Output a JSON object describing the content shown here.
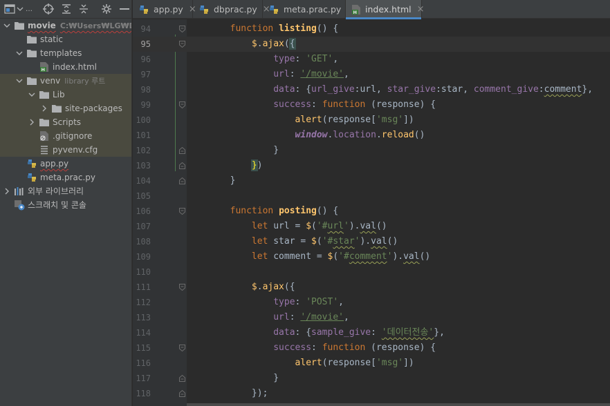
{
  "toolbar": {
    "icons": [
      "project-view-icon",
      "dropdown-icon",
      "locate-icon",
      "expand-all-icon",
      "collapse-all-icon",
      "settings-icon",
      "hide-icon"
    ]
  },
  "project_tree": [
    {
      "label": "movie",
      "hint": "C:₩Users₩LG₩Deskto",
      "level": 0,
      "arrow": "down",
      "icon": "folder",
      "bold": true,
      "wavy": true
    },
    {
      "label": "static",
      "hint": "",
      "level": 1,
      "arrow": "",
      "icon": "folder"
    },
    {
      "label": "templates",
      "hint": "",
      "level": 1,
      "arrow": "down",
      "icon": "folder"
    },
    {
      "label": "index.html",
      "hint": "",
      "level": 2,
      "arrow": "",
      "icon": "html"
    },
    {
      "label": "venv",
      "hint": "library 루트",
      "level": 0,
      "indent": 1,
      "arrow": "down",
      "icon": "folder",
      "venv": true
    },
    {
      "label": "Lib",
      "hint": "",
      "level": 2,
      "arrow": "down",
      "icon": "folder",
      "venv": true
    },
    {
      "label": "site-packages",
      "hint": "",
      "level": 3,
      "arrow": "right",
      "icon": "folder",
      "venv": true
    },
    {
      "label": "Scripts",
      "hint": "",
      "level": 2,
      "arrow": "right",
      "icon": "folder",
      "venv": true
    },
    {
      "label": ".gitignore",
      "hint": "",
      "level": 2,
      "arrow": "",
      "icon": "gitignore",
      "venv": true
    },
    {
      "label": "pyvenv.cfg",
      "hint": "",
      "level": 2,
      "arrow": "",
      "icon": "cfg",
      "venv": true
    },
    {
      "label": "app.py",
      "hint": "",
      "level": 1,
      "arrow": "",
      "icon": "python",
      "wavy": true
    },
    {
      "label": "meta.prac.py",
      "hint": "",
      "level": 1,
      "arrow": "",
      "icon": "python"
    },
    {
      "label": "외부 라이브러리",
      "hint": "",
      "level": 0,
      "arrow": "right",
      "icon": "library"
    },
    {
      "label": "스크래치 및 콘솔",
      "hint": "",
      "level": 0,
      "arrow": "",
      "icon": "scratch"
    }
  ],
  "tabs": [
    {
      "label": "app.py",
      "icon": "python",
      "active": false
    },
    {
      "label": "dbprac.py",
      "icon": "python",
      "active": false
    },
    {
      "label": "meta.prac.py",
      "icon": "python",
      "active": false
    },
    {
      "label": "index.html",
      "icon": "html",
      "active": true
    }
  ],
  "tab_close": "×",
  "editor": {
    "current_line": 95,
    "lines": [
      {
        "n": 94,
        "fold": "open",
        "tokens": [
          [
            "pl",
            "        "
          ],
          [
            "kw",
            "function "
          ],
          [
            "fnb",
            "listing"
          ],
          [
            "pl",
            "() {"
          ]
        ]
      },
      {
        "n": 95,
        "fold": "open",
        "tokens": [
          [
            "pl",
            "            "
          ],
          [
            "fn",
            "$"
          ],
          [
            "pl",
            "."
          ],
          [
            "fn",
            "ajax"
          ],
          [
            "pl",
            "("
          ],
          [
            "brk",
            "{"
          ]
        ]
      },
      {
        "n": 96,
        "fold": "",
        "tokens": [
          [
            "pl",
            "                "
          ],
          [
            "prop",
            "type"
          ],
          [
            "pl",
            ": "
          ],
          [
            "str",
            "'GET'"
          ],
          [
            "pl",
            ","
          ]
        ]
      },
      {
        "n": 97,
        "fold": "",
        "tokens": [
          [
            "pl",
            "                "
          ],
          [
            "prop",
            "url"
          ],
          [
            "pl",
            ": "
          ],
          [
            "stru",
            "'/movie'"
          ],
          [
            "pl",
            ","
          ]
        ]
      },
      {
        "n": 98,
        "fold": "",
        "tokens": [
          [
            "pl",
            "                "
          ],
          [
            "prop",
            "data"
          ],
          [
            "pl",
            ": {"
          ],
          [
            "prop",
            "url_give"
          ],
          [
            "pl",
            ":url, "
          ],
          [
            "prop",
            "star_give"
          ],
          [
            "pl",
            ":star, "
          ],
          [
            "prop",
            "comment_give"
          ],
          [
            "pl",
            ":"
          ],
          [
            "plw",
            "comment"
          ],
          [
            "pl",
            "},"
          ]
        ]
      },
      {
        "n": 99,
        "fold": "open",
        "tokens": [
          [
            "pl",
            "                "
          ],
          [
            "prop",
            "success"
          ],
          [
            "pl",
            ": "
          ],
          [
            "kw",
            "function "
          ],
          [
            "pl",
            "(response) {"
          ]
        ]
      },
      {
        "n": 100,
        "fold": "",
        "tokens": [
          [
            "pl",
            "                    "
          ],
          [
            "fn",
            "alert"
          ],
          [
            "pl",
            "(response["
          ],
          [
            "str",
            "'msg'"
          ],
          [
            "pl",
            "])"
          ]
        ]
      },
      {
        "n": 101,
        "fold": "",
        "tokens": [
          [
            "pl",
            "                    "
          ],
          [
            "glob",
            "window"
          ],
          [
            "pl",
            "."
          ],
          [
            "prop",
            "location"
          ],
          [
            "pl",
            "."
          ],
          [
            "fn",
            "reload"
          ],
          [
            "pl",
            "()"
          ]
        ]
      },
      {
        "n": 102,
        "fold": "close",
        "tokens": [
          [
            "pl",
            "                }"
          ]
        ]
      },
      {
        "n": 103,
        "fold": "close",
        "tokens": [
          [
            "pl",
            "            "
          ],
          [
            "brky",
            "}"
          ],
          [
            "pl",
            ")"
          ]
        ]
      },
      {
        "n": 104,
        "fold": "close",
        "tokens": [
          [
            "pl",
            "        }"
          ]
        ]
      },
      {
        "n": 105,
        "fold": "",
        "tokens": [
          [
            "pl",
            ""
          ]
        ]
      },
      {
        "n": 106,
        "fold": "open",
        "tokens": [
          [
            "pl",
            "        "
          ],
          [
            "kw",
            "function "
          ],
          [
            "fnb",
            "posting"
          ],
          [
            "pl",
            "() {"
          ]
        ]
      },
      {
        "n": 107,
        "fold": "",
        "tokens": [
          [
            "pl",
            "            "
          ],
          [
            "kw",
            "let "
          ],
          [
            "pl",
            "url = "
          ],
          [
            "fn",
            "$"
          ],
          [
            "pl",
            "("
          ],
          [
            "str",
            "'#"
          ],
          [
            "strw",
            "url"
          ],
          [
            "str",
            "'"
          ],
          [
            "pl",
            ")."
          ],
          [
            "plw",
            "val"
          ],
          [
            "pl",
            "()"
          ]
        ]
      },
      {
        "n": 108,
        "fold": "",
        "tokens": [
          [
            "pl",
            "            "
          ],
          [
            "kw",
            "let "
          ],
          [
            "pl",
            "star = "
          ],
          [
            "fn",
            "$"
          ],
          [
            "pl",
            "("
          ],
          [
            "str",
            "'#"
          ],
          [
            "strw",
            "star"
          ],
          [
            "str",
            "'"
          ],
          [
            "pl",
            ")."
          ],
          [
            "plw",
            "val"
          ],
          [
            "pl",
            "()"
          ]
        ]
      },
      {
        "n": 109,
        "fold": "",
        "tokens": [
          [
            "pl",
            "            "
          ],
          [
            "kw",
            "let "
          ],
          [
            "pl",
            "comment = "
          ],
          [
            "fn",
            "$"
          ],
          [
            "pl",
            "("
          ],
          [
            "str",
            "'#"
          ],
          [
            "strw",
            "comment"
          ],
          [
            "str",
            "'"
          ],
          [
            "pl",
            ")."
          ],
          [
            "plw",
            "val"
          ],
          [
            "pl",
            "()"
          ]
        ]
      },
      {
        "n": 110,
        "fold": "",
        "tokens": [
          [
            "pl",
            ""
          ]
        ]
      },
      {
        "n": 111,
        "fold": "open",
        "tokens": [
          [
            "pl",
            "            "
          ],
          [
            "fn",
            "$"
          ],
          [
            "pl",
            "."
          ],
          [
            "fn",
            "ajax"
          ],
          [
            "pl",
            "({"
          ]
        ]
      },
      {
        "n": 112,
        "fold": "",
        "tokens": [
          [
            "pl",
            "                "
          ],
          [
            "prop",
            "type"
          ],
          [
            "pl",
            ": "
          ],
          [
            "str",
            "'POST'"
          ],
          [
            "pl",
            ","
          ]
        ]
      },
      {
        "n": 113,
        "fold": "",
        "tokens": [
          [
            "pl",
            "                "
          ],
          [
            "prop",
            "url"
          ],
          [
            "pl",
            ": "
          ],
          [
            "stru",
            "'/movie'"
          ],
          [
            "pl",
            ","
          ]
        ]
      },
      {
        "n": 114,
        "fold": "",
        "tokens": [
          [
            "pl",
            "                "
          ],
          [
            "prop",
            "data"
          ],
          [
            "pl",
            ": {"
          ],
          [
            "prop",
            "sample_give"
          ],
          [
            "pl",
            ": "
          ],
          [
            "strw",
            "'데이터전송'"
          ],
          [
            "pl",
            "},"
          ]
        ]
      },
      {
        "n": 115,
        "fold": "open",
        "tokens": [
          [
            "pl",
            "                "
          ],
          [
            "prop",
            "success"
          ],
          [
            "pl",
            ": "
          ],
          [
            "kw",
            "function "
          ],
          [
            "pl",
            "(response) {"
          ]
        ]
      },
      {
        "n": 116,
        "fold": "",
        "tokens": [
          [
            "pl",
            "                    "
          ],
          [
            "fn",
            "alert"
          ],
          [
            "pl",
            "(response["
          ],
          [
            "str",
            "'msg'"
          ],
          [
            "pl",
            "])"
          ]
        ]
      },
      {
        "n": 117,
        "fold": "close",
        "tokens": [
          [
            "pl",
            "                }"
          ]
        ]
      },
      {
        "n": 118,
        "fold": "close",
        "tokens": [
          [
            "pl",
            "            });"
          ]
        ]
      }
    ]
  }
}
